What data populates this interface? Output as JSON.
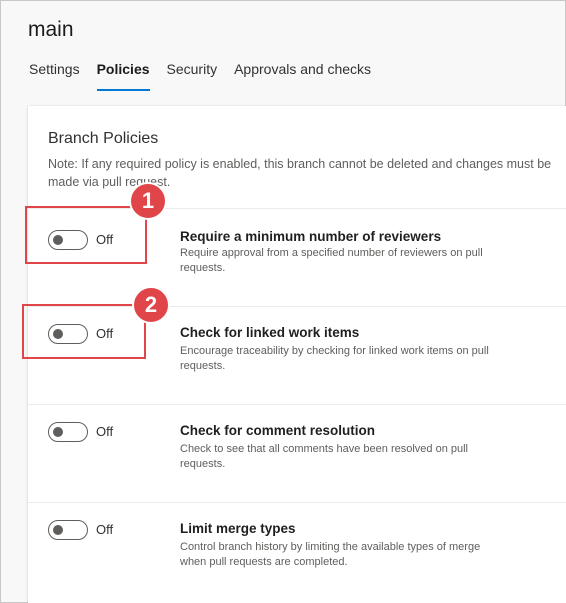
{
  "page": {
    "title": "main",
    "tabs": [
      {
        "label": "Settings"
      },
      {
        "label": "Policies"
      },
      {
        "label": "Security"
      },
      {
        "label": "Approvals and checks"
      }
    ],
    "active_tab": "Policies"
  },
  "branch_policies": {
    "title": "Branch Policies",
    "note": "Note: If any required policy is enabled, this branch cannot be deleted and changes must be made via pull request.",
    "policies": [
      {
        "state": "Off",
        "name": "Require a minimum number of reviewers",
        "description": "Require approval from a specified number of reviewers on pull requests."
      },
      {
        "state": "Off",
        "name": "Check for linked work items",
        "description": "Encourage traceability by checking for linked work items on pull requests."
      },
      {
        "state": "Off",
        "name": "Check for comment resolution",
        "description": "Check to see that all comments have been resolved on pull requests."
      },
      {
        "state": "Off",
        "name": "Limit merge types",
        "description": "Control branch history by limiting the available types of merge when pull requests are completed."
      }
    ]
  },
  "callouts": [
    {
      "number": "1"
    },
    {
      "number": "2"
    }
  ],
  "colors": {
    "accent": "#0078d4",
    "callout": "#e0454a"
  }
}
